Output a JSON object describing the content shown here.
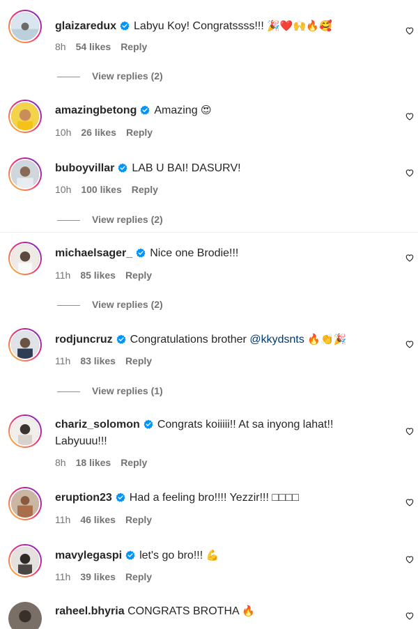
{
  "comments": [
    {
      "username": "glaizaredux",
      "text": "Labyu Koy! Congratssss!!!",
      "emoji": "🎉❤️🙌🔥🥰",
      "time": "8h",
      "likes": "54 likes",
      "reply": "Reply",
      "view_replies": "View replies (2)"
    },
    {
      "username": "amazingbetong",
      "text": "Amazing",
      "emoji": "😍",
      "time": "10h",
      "likes": "26 likes",
      "reply": "Reply"
    },
    {
      "username": "buboyvillar",
      "text": "LAB U BAI! DASURV!",
      "time": "10h",
      "likes": "100 likes",
      "reply": "Reply",
      "view_replies": "View replies (2)"
    },
    {
      "username": "michaelsager_",
      "text": "Nice one Brodie!!!",
      "time": "11h",
      "likes": "85 likes",
      "reply": "Reply",
      "view_replies": "View replies (2)"
    },
    {
      "username": "rodjuncruz",
      "text": "Congratulations brother",
      "mention": "@kkydsnts",
      "emoji": "🔥👏🎉",
      "time": "11h",
      "likes": "83 likes",
      "reply": "Reply",
      "view_replies": "View replies (1)"
    },
    {
      "username": "chariz_solomon",
      "text": "Congrats koiiiii!! At sa inyong lahat!! Labyuuu!!!",
      "time": "8h",
      "likes": "18 likes",
      "reply": "Reply"
    },
    {
      "username": "eruption23",
      "text": "Had a feeling bro!!!! Yezzir!!! □□□□",
      "time": "11h",
      "likes": "46 likes",
      "reply": "Reply"
    },
    {
      "username": "mavylegaspi",
      "text": "let's go bro!!!",
      "emoji": "💪",
      "time": "11h",
      "likes": "39 likes",
      "reply": "Reply"
    },
    {
      "username": "raheel.bhyria",
      "text": "CONGRATS BROTHA",
      "emoji": "🔥"
    }
  ],
  "colors": {
    "text": "#262626",
    "meta": "#737373",
    "mention": "#00376b",
    "verified": "#0095f6"
  },
  "icons": {
    "verified": "verified-badge-icon",
    "like": "heart-outline-icon"
  }
}
